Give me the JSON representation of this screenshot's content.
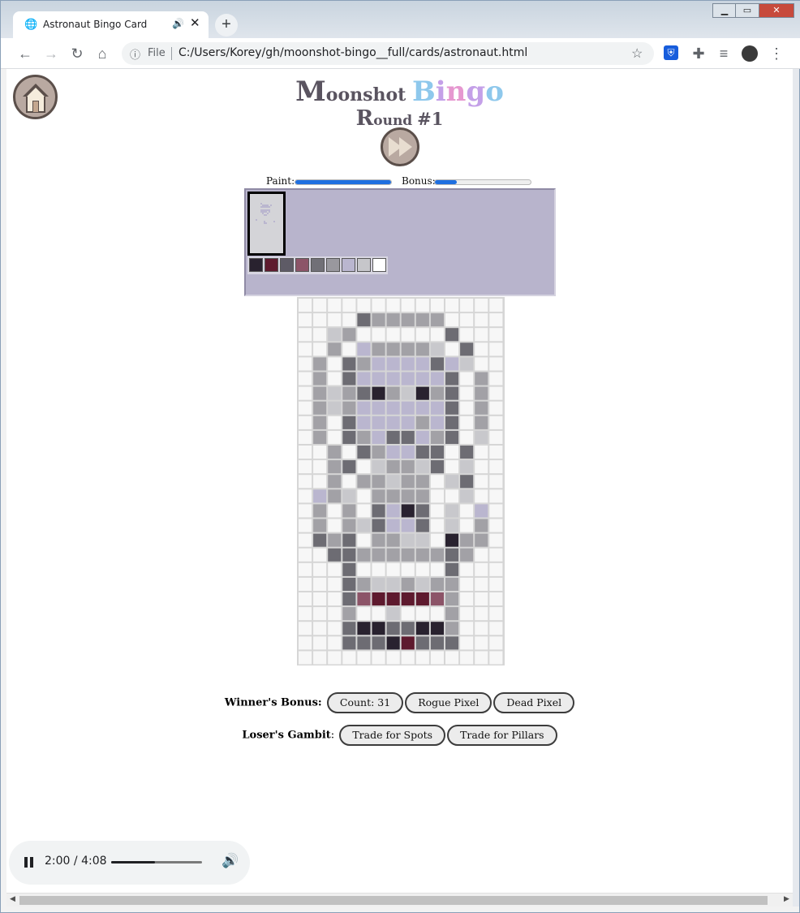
{
  "browser": {
    "tab_title": "Astronaut Bingo Card",
    "new_tab_label": "+",
    "url_scheme_label": "File",
    "url": "C:/Users/Korey/gh/moonshot-bingo__full/cards/astronaut.html",
    "window_controls": {
      "minimize": "▁",
      "maximize": "▭",
      "close": "✕"
    }
  },
  "page": {
    "title_word1_cap": "M",
    "title_word1_rest": "oonshot",
    "title_word2_letters": [
      "B",
      "i",
      "n",
      "g",
      "o"
    ],
    "round_cap": "R",
    "round_rest": "ound",
    "round_number": "#1",
    "paint_label": "Paint:",
    "paint_level": 1.0,
    "bonus_label": "Bonus:",
    "bonus_level": 0.23,
    "palette_colors": [
      "#29222f",
      "#5e1a2e",
      "#5e5b66",
      "#8c5468",
      "#717077",
      "#99989e",
      "#bab6cf",
      "#c6c6ca",
      "#ffffff"
    ],
    "winners_bonus_label": "Winner's Bonus:",
    "winners_bonus_buttons": [
      "Count: 31",
      "Rogue Pixel",
      "Dead Pixel"
    ],
    "losers_gambit_label": "Loser's Gambit",
    "losers_gambit_colon": ":",
    "losers_gambit_buttons": [
      "Trade for Spots",
      "Trade for Pillars"
    ]
  },
  "audio_player": {
    "current_time": "2:00",
    "separator": " / ",
    "duration": "4:08",
    "progress": 0.484
  },
  "pixel_art": {
    "columns": 14,
    "rows": 25,
    "legend": {
      "W": "#f7f7f7",
      "L": "#c8c8cc",
      "M": "#a2a1a6",
      "D": "#6d6c73",
      "K": "#29222f",
      "R": "#5e1a2e",
      "P": "#8c5468",
      "V": "#bab6cf"
    },
    "pixels": [
      "WWWWWWWWWWWWWW",
      "WWWWDMMMMMWWWW",
      "WWLMWWWWWWDWWW",
      "WWMWVMMMMLWDWW",
      "WMWDMVVVVDVLWW",
      "WMWDVVVVVVDWMW",
      "WMLMDKMLKMDWMW",
      "WMLMVVVVVVDWMW",
      "WMWDVVVVMVDWMW",
      "WMWDMVDDVMDWLW",
      "WWMWDMVVDDWDWW",
      "WWMDWLMMLDWLWW",
      "WWMWMMLMMWLDWW",
      "WVMLWMMMMWWLWW",
      "WMWMWDVKDWLWVW",
      "WMWMLDVVDWLWMW",
      "WDMDWMMLLWKMMW",
      "WWDDMMMMMMDMWW",
      "WWWDWWWWWWDWWW",
      "WWWDMLLMLMMWWW",
      "WWWDPRRRRPMWWW",
      "WWWMWWLWWWMWWW",
      "WWWDKKDDKKMWWW",
      "WWWDDDKRDDDWWW",
      "WWWWWWWWWWWWWW"
    ]
  }
}
